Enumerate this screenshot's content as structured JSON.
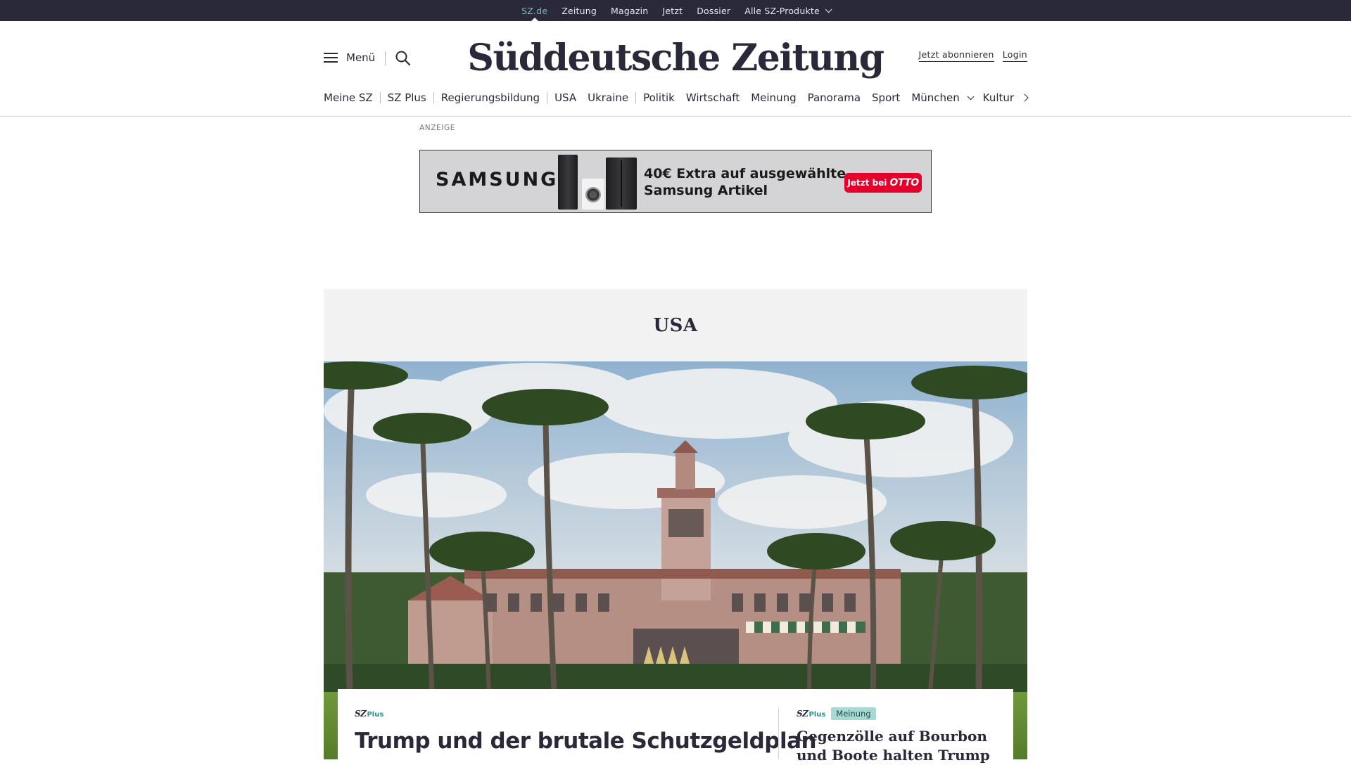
{
  "topbar": {
    "items": [
      "SZ.de",
      "Zeitung",
      "Magazin",
      "Jetzt",
      "Dossier"
    ],
    "products_label": "Alle SZ-Produkte"
  },
  "header": {
    "menu_label": "Menü",
    "logo_text": "Süddeutsche Zeitung",
    "subscribe_label": "Jetzt abonnieren",
    "login_label": "Login"
  },
  "nav": {
    "items": [
      "Meine SZ",
      "SZ Plus",
      "Regierungsbildung",
      "USA",
      "Ukraine",
      "Politik",
      "Wirtschaft",
      "Meinung",
      "Panorama",
      "Sport",
      "München",
      "Kultur"
    ]
  },
  "ad": {
    "label": "ANZEIGE",
    "brand": "SAMSUNG",
    "text_line1": "40€ Extra auf ausgewählte",
    "text_line2": "Samsung Artikel",
    "cta_prefix": "Jetzt bei",
    "cta_shop": "OTTO"
  },
  "section": {
    "title": "USA"
  },
  "teasers": {
    "main": {
      "sz": "SZ",
      "plus": "Plus",
      "headline": "Trump und der brutale Schutzgeldplan"
    },
    "side": {
      "sz": "SZ",
      "plus": "Plus",
      "badge": "Meinung",
      "headline_line1": "Gegenzölle auf Bourbon",
      "headline_line2": "und Boote halten Trump"
    }
  },
  "colors": {
    "topbar_bg": "#29293a",
    "active_link": "#7fb4c2",
    "badge_bg": "#a7d8d1",
    "szplus_accent": "#2f8f8a",
    "ad_cta": "#e4002b"
  }
}
